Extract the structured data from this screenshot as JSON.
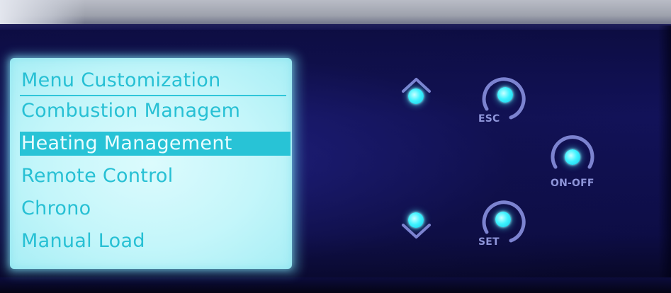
{
  "lcd": {
    "title": "Menu Customization",
    "items": [
      {
        "label": "Combustion Managem",
        "selected": false
      },
      {
        "label": "Heating Management",
        "selected": true
      },
      {
        "label": "Remote Control",
        "selected": false
      },
      {
        "label": "Chrono",
        "selected": false
      },
      {
        "label": "Manual Load",
        "selected": false
      }
    ]
  },
  "buttons": {
    "esc_label": "ESC",
    "set_label": "SET",
    "onoff_label": "ON-OFF"
  },
  "colors": {
    "lcd_background": "#c4f6fa",
    "lcd_text": "#27c0d4",
    "selection_bar": "#28c3d6",
    "led": "#3ff3ff",
    "button_label": "#8e95d9",
    "panel": "#12125a"
  },
  "icons": {
    "up": "chevron-up-icon",
    "down": "chevron-down-icon",
    "esc": "arc-ring-icon",
    "set": "arc-ring-icon",
    "onoff": "arc-ring-icon"
  }
}
